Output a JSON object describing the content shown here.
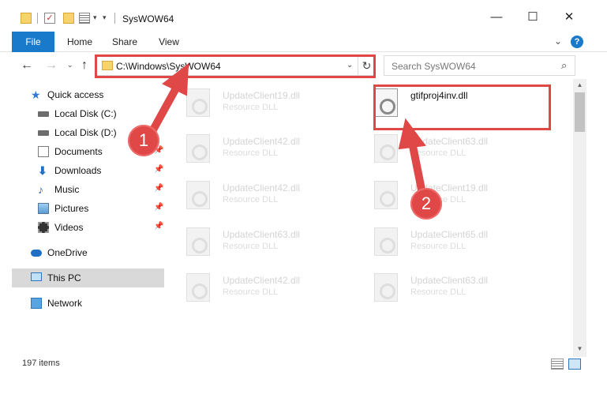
{
  "window": {
    "title": "SysWOW64",
    "minimize": "—",
    "maximize": "☐",
    "close": "✕"
  },
  "ribbon": {
    "tabs": [
      "File",
      "Home",
      "Share",
      "View"
    ],
    "expand": "⌄",
    "help": "?"
  },
  "nav": {
    "back": "←",
    "forward": "→",
    "recent": "⌄",
    "up": "↑",
    "address": "C:\\Windows\\SysWOW64",
    "refresh": "↻",
    "search_placeholder": "Search SysWOW64",
    "search_icon": "⌕"
  },
  "sidebar": {
    "items": [
      {
        "label": "Quick access",
        "icon": "star-icon",
        "pinned": false
      },
      {
        "label": "Local Disk (C:)",
        "icon": "disk-icon",
        "pinned": false
      },
      {
        "label": "Local Disk (D:)",
        "icon": "disk-icon",
        "pinned": false
      },
      {
        "label": "Documents",
        "icon": "documents-icon",
        "pinned": true
      },
      {
        "label": "Downloads",
        "icon": "download-icon",
        "pinned": true
      },
      {
        "label": "Music",
        "icon": "music-icon",
        "pinned": true
      },
      {
        "label": "Pictures",
        "icon": "pictures-icon",
        "pinned": true
      },
      {
        "label": "Videos",
        "icon": "videos-icon",
        "pinned": true
      },
      {
        "label": "OneDrive",
        "icon": "onedrive-icon",
        "pinned": false
      },
      {
        "label": "This PC",
        "icon": "pc-icon",
        "pinned": false,
        "selected": true
      },
      {
        "label": "Network",
        "icon": "network-icon",
        "pinned": false
      }
    ]
  },
  "files": [
    {
      "name": "UpdateClient19.dll",
      "type": "Resource DLL"
    },
    {
      "name": "gtifproj4inv.dll",
      "type": "",
      "highlighted": true
    },
    {
      "name": "UpdateClient42.dll",
      "type": "Resource DLL"
    },
    {
      "name": "UpdateClient63.dll",
      "type": "Resource DLL"
    },
    {
      "name": "UpdateClient42.dll",
      "type": "Resource DLL"
    },
    {
      "name": "UpdateClient19.dll",
      "type": "Resource DLL"
    },
    {
      "name": "UpdateClient63.dll",
      "type": "Resource DLL"
    },
    {
      "name": "UpdateClient65.dll",
      "type": "Resource DLL"
    },
    {
      "name": "UpdateClient42.dll",
      "type": "Resource DLL"
    },
    {
      "name": "UpdateClient63.dll",
      "type": "Resource DLL"
    }
  ],
  "status": {
    "item_count": "197 items"
  },
  "callouts": [
    "1",
    "2"
  ],
  "colors": {
    "accent": "#1979ca",
    "annotation": "#e04848"
  }
}
